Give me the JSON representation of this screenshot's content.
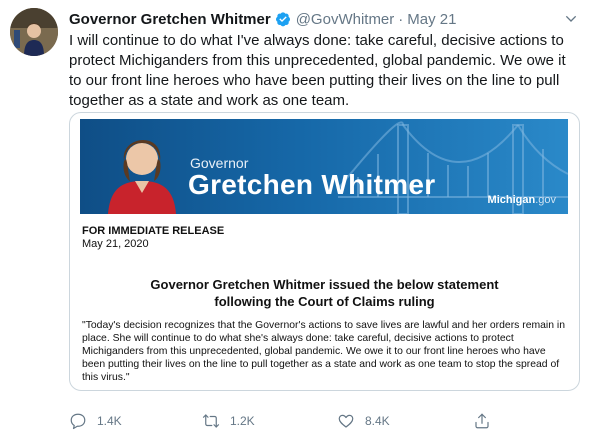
{
  "author": {
    "name": "Governor Gretchen Whitmer",
    "handle": "@GovWhitmer",
    "separator": "·",
    "date": "May 21"
  },
  "tweet": {
    "text": "I will continue to do what I've always done: take careful, decisive actions to protect Michiganders from this unprecedented, global pandemic. We owe it to our front line heroes who have been putting their lives on the line to pull together as a state and work as one team."
  },
  "card": {
    "banner": {
      "small_title": "Governor",
      "big_title": "Gretchen Whitmer",
      "logo_main": "Michigan",
      "logo_suffix": ".gov"
    },
    "release_label": "FOR IMMEDIATE RELEASE",
    "release_date": "May 21, 2020",
    "statement_title_line1": "Governor Gretchen Whitmer issued the below statement",
    "statement_title_line2": "following the Court of Claims ruling",
    "quote": "\"Today's decision recognizes that the Governor's actions to save lives are lawful and her orders remain in place. She will continue to do what she's always done: take careful, decisive actions to protect Michiganders from this unprecedented, global pandemic. We owe it to our front line heroes who have been putting their lives on the line to pull together as a state and work as one team to stop the spread of this virus.\""
  },
  "actions": {
    "replies": "1.4K",
    "retweets": "1.2K",
    "likes": "8.4K"
  },
  "icons": {
    "verified": "verified-badge-icon",
    "caret": "chevron-down-icon",
    "reply": "reply-icon",
    "retweet": "retweet-icon",
    "like": "heart-icon",
    "share": "share-icon"
  },
  "colors": {
    "verified_blue": "#1da1f2",
    "meta_gray": "#657786",
    "banner_blue": "#1668a8"
  }
}
